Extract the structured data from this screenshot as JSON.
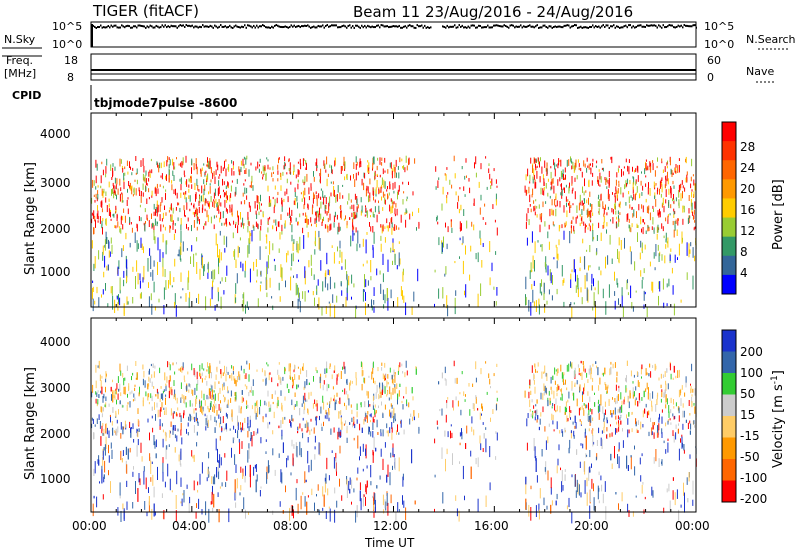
{
  "header": {
    "station": "TIGER (fitACF)",
    "beam_date": "Beam 11  23/Aug/2016 - 24/Aug/2016"
  },
  "nsky_panel": {
    "left_label": "N.Sky",
    "right_label": "N.Search",
    "y_ticks": [
      "10^5",
      "10^0"
    ],
    "right_ticks": [
      "10^5",
      "10^0"
    ]
  },
  "freq_panel": {
    "left_label_1": "Freq.",
    "left_label_2": "[MHz]",
    "y_ticks": [
      "18",
      "8"
    ],
    "right_ticks": [
      "60",
      "0"
    ],
    "right_label": "Nave"
  },
  "cpid": {
    "label": "CPID",
    "value": "tbjmode7pulse  -8600"
  },
  "x_axis": {
    "ticks": [
      "00:00",
      "04:00",
      "08:00",
      "12:00",
      "16:00",
      "20:00",
      "00:00"
    ],
    "label": "Time UT"
  },
  "panels": {
    "y_label": "Slant Range [km]",
    "y_ticks": [
      "4000",
      "3000",
      "2000",
      "1000"
    ]
  },
  "power_colorbar": {
    "label": "Power [dB]",
    "ticks": [
      "28",
      "24",
      "20",
      "16",
      "12",
      "8",
      "4"
    ],
    "colors": [
      "#ff0000",
      "#ff3300",
      "#ff6600",
      "#ff9900",
      "#ffcc00",
      "#99cc33",
      "#339966",
      "#336699",
      "#0000ff"
    ]
  },
  "velocity_colorbar": {
    "label": "Velocity [m s",
    "label_sup": "-1",
    "label_end": "]",
    "ticks": [
      "200",
      "100",
      "50",
      "15",
      "-15",
      "-50",
      "-100",
      "-200"
    ],
    "colors": [
      "#1a33cc",
      "#3366aa",
      "#33cc33",
      "#cccccc",
      "#ffcc66",
      "#ff9900",
      "#ff6600",
      "#ff0000"
    ]
  },
  "chart_data": [
    {
      "type": "heatmap",
      "title": "Power",
      "x_range": [
        "00:00",
        "00:00"
      ],
      "xlabel": "Time UT",
      "ylabel": "Slant Range [km]",
      "ylim": [
        180,
        4500
      ],
      "colorbar_label": "Power [dB]",
      "colorbar_range": [
        0,
        32
      ],
      "data_gaps_hours": [
        [
          13.0,
          13.6
        ],
        [
          16.1,
          17.2
        ]
      ],
      "dense_band_km": [
        1950,
        3550
      ]
    },
    {
      "type": "heatmap",
      "title": "Velocity",
      "x_range": [
        "00:00",
        "00:00"
      ],
      "xlabel": "Time UT",
      "ylabel": "Slant Range [km]",
      "ylim": [
        180,
        4500
      ],
      "colorbar_label": "Velocity [m s-1]",
      "colorbar_range": [
        -250,
        250
      ],
      "data_gaps_hours": [
        [
          13.0,
          13.6
        ],
        [
          16.1,
          17.2
        ]
      ],
      "dense_band_km": [
        1950,
        3550
      ]
    }
  ]
}
